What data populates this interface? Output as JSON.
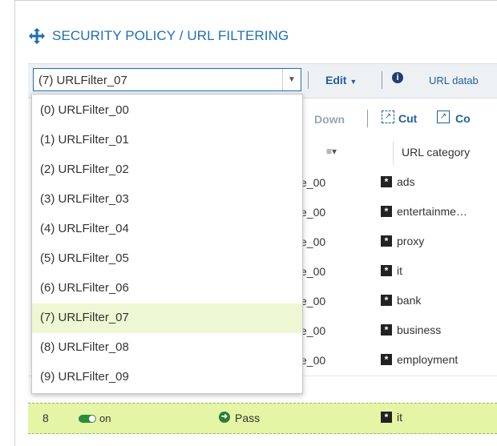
{
  "title": "SECURITY POLICY / URL FILTERING",
  "toolbar": {
    "select_value": "(7) URLFilter_07",
    "edit_label": "Edit",
    "info_icon": "info-icon",
    "url_db_label": "URL datab"
  },
  "toolbar2": {
    "down_label": "Down",
    "cut_label": "Cut",
    "copy_label": "Co"
  },
  "columns": {
    "url_category": "URL category"
  },
  "rows": [
    {
      "name": "e_00",
      "category": "ads"
    },
    {
      "name": "e_00",
      "category": "entertainme…"
    },
    {
      "name": "e_00",
      "category": "proxy"
    },
    {
      "name": "e_00",
      "category": "it"
    },
    {
      "name": "e_00",
      "category": "bank"
    },
    {
      "name": "e_00",
      "category": "business"
    },
    {
      "name": "e_00",
      "category": "employment"
    }
  ],
  "selected_row": {
    "number": "8",
    "status": "on",
    "action": "Pass",
    "category": "it"
  },
  "dropdown": {
    "options": [
      "(0) URLFilter_00",
      "(1) URLFilter_01",
      "(2) URLFilter_02",
      "(3) URLFilter_03",
      "(4) URLFilter_04",
      "(5) URLFilter_05",
      "(6) URLFilter_06",
      "(7) URLFilter_07",
      "(8) URLFilter_08",
      "(9) URLFilter_09"
    ],
    "selected_index": 7
  },
  "colors": {
    "accent": "#1f6fb5",
    "selected_row_bg": "#e4f5a6",
    "selected_option_bg": "#eef7d4",
    "toggle_on": "#2e8b3c"
  }
}
